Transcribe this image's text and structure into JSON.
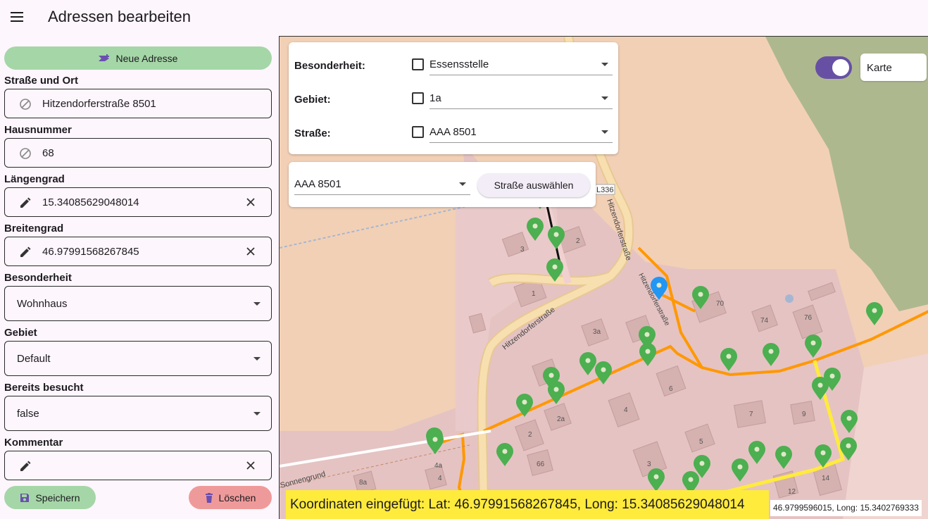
{
  "app": {
    "title": "Adressen bearbeiten"
  },
  "panel": {
    "new_address_label": "Neue Adresse",
    "street_label": "Straße und Ort",
    "street_value": "Hitzendorferstraße 8501",
    "house_label": "Hausnummer",
    "house_value": "68",
    "lon_label": "Längengrad",
    "lon_value": "15.34085629048014",
    "lat_label": "Breitengrad",
    "lat_value": "46.97991568267845",
    "special_label": "Besonderheit",
    "special_value": "Wohnhaus",
    "area_label": "Gebiet",
    "area_value": "Default",
    "visited_label": "Bereits besucht",
    "visited_value": "false",
    "comment_label": "Kommentar",
    "comment_value": "",
    "save_label": "Speichern",
    "delete_label": "Löschen"
  },
  "filters": {
    "special_label": "Besonderheit:",
    "special_value": "Essensstelle",
    "area_label": "Gebiet:",
    "area_value": "1a",
    "street_label": "Straße:",
    "street_value": "AAA  8501"
  },
  "street_select": {
    "value": "AAA  8501",
    "button_label": "Straße auswählen"
  },
  "map_controls": {
    "toggle_on": true,
    "layer_label": "Karte"
  },
  "map_labels": {
    "road1": "Hitzendorferstraße",
    "road2": "Hitzendorferstraße",
    "road3": "Hitzendorferstraße",
    "road4": "Sonnengrund",
    "road_ref": "L336",
    "house_numbers": [
      "3",
      "2",
      "1",
      "70",
      "74",
      "76",
      "3a",
      "5",
      "1",
      "6",
      "4",
      "2a",
      "2",
      "7",
      "9",
      "5",
      "3",
      "66",
      "4a",
      "4",
      "8a",
      "12",
      "14"
    ]
  },
  "status": {
    "toast": "Koordinaten eingefügt: Lat: 46.97991568267845, Long: 15.34085629048014",
    "readout": "46.9799596015, Long: 15.3402769333"
  },
  "colors": {
    "accent": "#6750a4",
    "green_button": "#a5d6a7",
    "red_button": "#ef9a9a",
    "toast_bg": "#ffeb3b",
    "marker_green": "#4caf50",
    "marker_blue": "#2196f3",
    "route_orange": "#ff9800"
  }
}
